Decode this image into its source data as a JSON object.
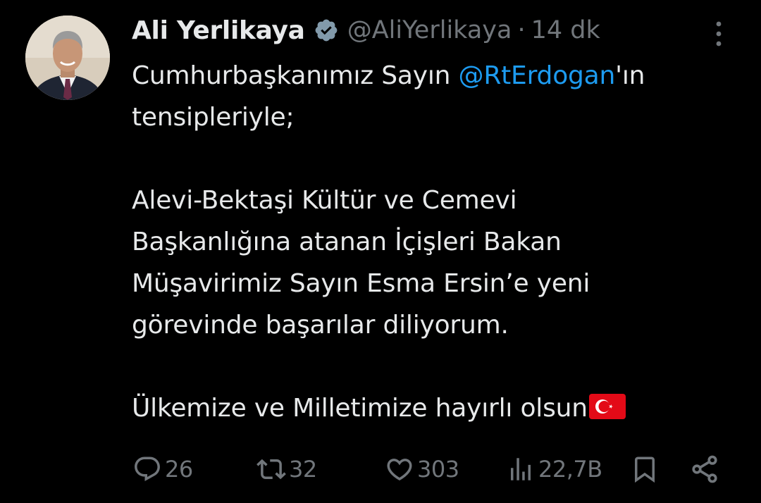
{
  "tweet": {
    "author": {
      "display_name": "Ali Yerlikaya",
      "handle": "@AliYerlikaya",
      "separator": "·",
      "time": "14 dk"
    },
    "body": {
      "line1_prefix": "Cumhurbaşkanımız Sayın ",
      "mention": "@RtErdogan",
      "line1_suffix": "'ın",
      "line2": "tensipleriyle;",
      "line3": "Alevi-Bektaşi Kültür ve Cemevi",
      "line4": "Başkanlığına atanan İçişleri Bakan",
      "line5": "Müşavirimiz Sayın Esma Ersin’e yeni",
      "line6": "görevinde başarılar diliyorum.",
      "line7": "Ülkemize ve Milletimize hayırlı olsun"
    },
    "actions": {
      "replies": "26",
      "retweets": "32",
      "likes": "303",
      "views": "22,7B"
    }
  },
  "colors": {
    "background": "#000000",
    "text": "#e7e9ea",
    "muted": "#71767b",
    "link": "#1d9bf0"
  },
  "icons": [
    "verified-badge-icon",
    "more-icon",
    "reply-icon",
    "retweet-icon",
    "like-icon",
    "views-icon",
    "bookmark-icon",
    "share-icon",
    "turkey-flag-icon"
  ]
}
